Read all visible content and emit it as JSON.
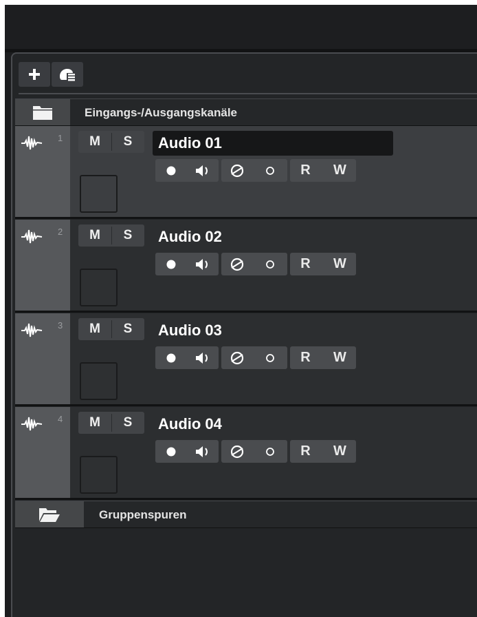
{
  "toolbar": {
    "add_icon": "plus-icon",
    "track_presets_icon": "track-presets-icon"
  },
  "folders": {
    "io_channels": {
      "label": "Eingangs-/Ausgangskanäle",
      "icon": "folder-icon"
    },
    "group_tracks": {
      "label": "Gruppenspuren",
      "icon": "folder-open-icon"
    }
  },
  "tracks": [
    {
      "number": "1",
      "name": "Audio 01",
      "selected": true,
      "mute": "M",
      "solo": "S",
      "read": "R",
      "write": "W"
    },
    {
      "number": "2",
      "name": "Audio 02",
      "selected": false,
      "mute": "M",
      "solo": "S",
      "read": "R",
      "write": "W"
    },
    {
      "number": "3",
      "name": "Audio 03",
      "selected": false,
      "mute": "M",
      "solo": "S",
      "read": "R",
      "write": "W"
    },
    {
      "number": "4",
      "name": "Audio 04",
      "selected": false,
      "mute": "M",
      "solo": "S",
      "read": "R",
      "write": "W"
    }
  ],
  "colors": {
    "background": "#232527",
    "track_header": "#56585b",
    "button": "#4a4c4f",
    "text": "#ffffff"
  }
}
